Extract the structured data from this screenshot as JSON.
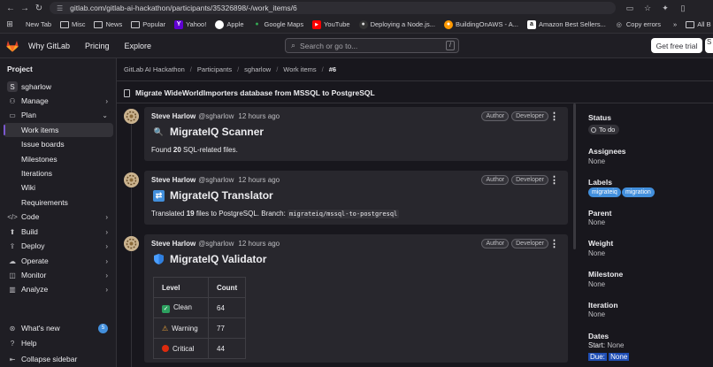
{
  "browser": {
    "url": "gitlab.com/gitlab-ai-hackathon/participants/35326898/-/work_items/6",
    "bookmarks": [
      "New Tab",
      "Misc",
      "News",
      "Popular",
      "Yahoo!",
      "Apple",
      "Google Maps",
      "YouTube",
      "Deploying a Node.js...",
      "BuildingOnAWS - A...",
      "Amazon Best Sellers...",
      "Copy errors"
    ],
    "more": "»",
    "all_bookmarks": "All B"
  },
  "topbar": {
    "nav": [
      "Why GitLab",
      "Pricing",
      "Explore"
    ],
    "search_placeholder": "Search or go to...",
    "search_kbd": "/",
    "trial_label": "Get free trial",
    "signin_label": "S"
  },
  "sidebar": {
    "heading": "Project",
    "project_initial": "S",
    "project_name": "sgharlow",
    "items": [
      {
        "label": "Manage"
      },
      {
        "label": "Plan"
      },
      {
        "label": "Work items"
      },
      {
        "label": "Issue boards"
      },
      {
        "label": "Milestones"
      },
      {
        "label": "Iterations"
      },
      {
        "label": "Wiki"
      },
      {
        "label": "Requirements"
      },
      {
        "label": "Code"
      },
      {
        "label": "Build"
      },
      {
        "label": "Deploy"
      },
      {
        "label": "Operate"
      },
      {
        "label": "Monitor"
      },
      {
        "label": "Analyze"
      }
    ],
    "whats_new": "What's new",
    "whats_new_count": "5",
    "help": "Help",
    "collapse": "Collapse sidebar"
  },
  "breadcrumb": [
    "GitLab AI Hackathon",
    "Participants",
    "sgharlow",
    "Work items",
    "#6"
  ],
  "work_item_title": "Migrate WideWorldImporters database from MSSQL to PostgreSQL",
  "notes": [
    {
      "author": "Steve Harlow",
      "handle": "@sgharlow",
      "time": "12 hours ago",
      "badges": [
        "Author",
        "Developer"
      ],
      "title": "MigrateIQ Scanner",
      "body_prefix": "Found ",
      "body_bold": "20",
      "body_suffix": " SQL-related files."
    },
    {
      "author": "Steve Harlow",
      "handle": "@sgharlow",
      "time": "12 hours ago",
      "badges": [
        "Author",
        "Developer"
      ],
      "title": "MigrateIQ Translator",
      "body_prefix": "Translated ",
      "body_bold": "19",
      "body_suffix": " files to PostgreSQL. Branch: ",
      "branch": "migrateiq/mssql-to-postgresql"
    },
    {
      "author": "Steve Harlow",
      "handle": "@sgharlow",
      "time": "12 hours ago",
      "badges": [
        "Author",
        "Developer"
      ],
      "title": "MigrateIQ Validator",
      "table": {
        "headers": [
          "Level",
          "Count"
        ],
        "rows": [
          {
            "level": "Clean",
            "count": "64",
            "icon": "check-square-icon"
          },
          {
            "level": "Warning",
            "count": "77",
            "icon": "warning-icon"
          },
          {
            "level": "Critical",
            "count": "44",
            "icon": "red-circle-icon"
          }
        ]
      }
    }
  ],
  "right_panel": {
    "status_label": "Status",
    "status_value": "To do",
    "assignees_label": "Assignees",
    "assignees_value": "None",
    "labels_label": "Labels",
    "labels": [
      "migrateiq",
      "migration"
    ],
    "parent_label": "Parent",
    "parent_value": "None",
    "weight_label": "Weight",
    "weight_value": "None",
    "milestone_label": "Milestone",
    "milestone_value": "None",
    "iteration_label": "Iteration",
    "iteration_value": "None",
    "dates_label": "Dates",
    "start_label": "Start:",
    "start_value": "None",
    "due_label": "Due:",
    "due_value": "None"
  },
  "colors": {
    "accent": "#7b58cf",
    "label_blue": "#428fdc",
    "background": "#18171d"
  }
}
